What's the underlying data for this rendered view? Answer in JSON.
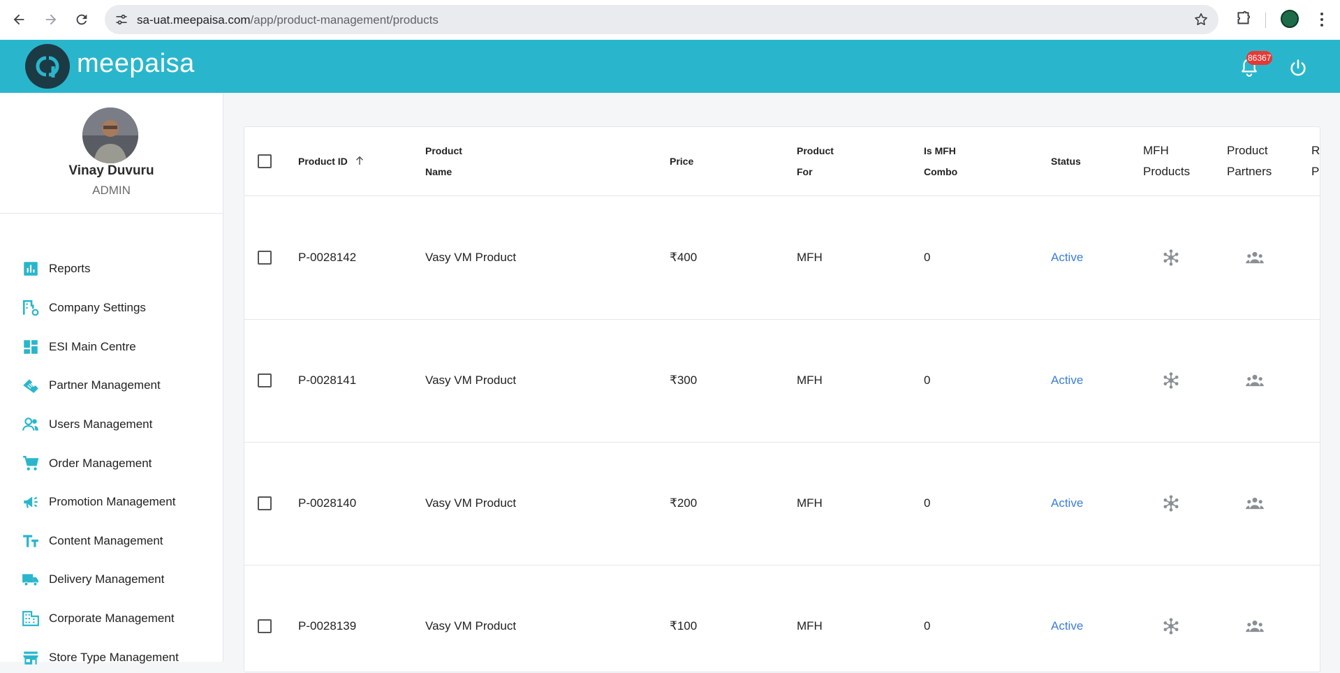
{
  "browser": {
    "url_host": "sa-uat.meepaisa.com",
    "url_path": "/app/product-management/products"
  },
  "header": {
    "logo_text": "meepaisa",
    "notification_count": "86367"
  },
  "user": {
    "name": "Vinay Duvuru",
    "role": "ADMIN"
  },
  "sidebar": {
    "items": [
      {
        "label": "Reports",
        "icon": "bar-chart-icon"
      },
      {
        "label": "Company Settings",
        "icon": "company-settings-icon"
      },
      {
        "label": "ESI Main Centre",
        "icon": "dashboard-icon"
      },
      {
        "label": "Partner Management",
        "icon": "handshake-icon"
      },
      {
        "label": "Users Management",
        "icon": "users-icon"
      },
      {
        "label": "Order Management",
        "icon": "cart-icon"
      },
      {
        "label": "Promotion Management",
        "icon": "megaphone-icon"
      },
      {
        "label": "Content Management",
        "icon": "text-fields-icon"
      },
      {
        "label": "Delivery Management",
        "icon": "truck-icon"
      },
      {
        "label": "Corporate Management",
        "icon": "building-icon"
      },
      {
        "label": "Store Type Management",
        "icon": "store-icon"
      }
    ]
  },
  "table": {
    "columns": {
      "product_id": "Product ID",
      "product_name_1": "Product",
      "product_name_2": "Name",
      "price": "Price",
      "product_for_1": "Product",
      "product_for_2": "For",
      "is_mfh_1": "Is MFH",
      "is_mfh_2": "Combo",
      "status": "Status",
      "mfh_products_1": "MFH",
      "mfh_products_2": "Products",
      "product_partners_1": "Product",
      "product_partners_2": "Partners",
      "partial_1": "R",
      "partial_2": "P"
    },
    "rows": [
      {
        "id": "P-0028142",
        "name": "Vasy VM Product",
        "price": "₹400",
        "for": "MFH",
        "combo": "0",
        "status": "Active"
      },
      {
        "id": "P-0028141",
        "name": "Vasy VM Product",
        "price": "₹300",
        "for": "MFH",
        "combo": "0",
        "status": "Active"
      },
      {
        "id": "P-0028140",
        "name": "Vasy VM Product",
        "price": "₹200",
        "for": "MFH",
        "combo": "0",
        "status": "Active"
      },
      {
        "id": "P-0028139",
        "name": "Vasy VM Product",
        "price": "₹100",
        "for": "MFH",
        "combo": "0",
        "status": "Active"
      }
    ]
  },
  "colors": {
    "brand": "#29b6cc",
    "status_active": "#3b7ddd",
    "badge": "#e53935"
  }
}
